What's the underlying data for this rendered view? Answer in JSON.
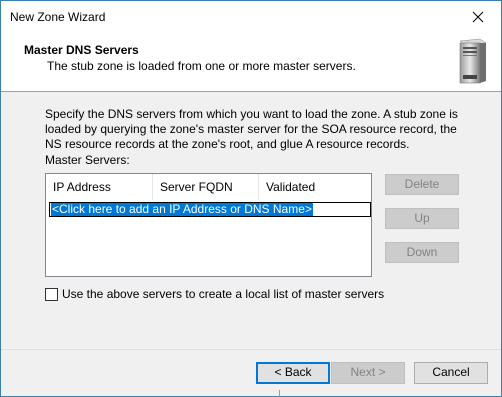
{
  "window": {
    "title": "New Zone Wizard"
  },
  "header": {
    "title": "Master DNS Servers",
    "subtitle": "The stub zone is loaded from one or more master servers."
  },
  "content": {
    "description": "Specify the DNS servers from which you want to load the zone. A stub zone is loaded by querying the zone's master server for the SOA resource record, the NS resource records at the zone's root, and glue A resource records.",
    "master_servers_label": "Master Servers:",
    "columns": [
      "IP Address",
      "Server FQDN",
      "Validated"
    ],
    "add_row_text": "<Click here to add an IP Address or DNS Name>",
    "side_buttons": {
      "delete": "Delete",
      "up": "Up",
      "down": "Down"
    },
    "checkbox": {
      "label": "Use the above servers to create a local list of master servers",
      "checked": false
    }
  },
  "footer": {
    "back": "< Back",
    "next": "Next >",
    "cancel": "Cancel"
  },
  "colors": {
    "accent": "#0078d7",
    "border": "#3c7fb1"
  },
  "icons": {
    "close": "close-icon",
    "server": "server-icon"
  }
}
